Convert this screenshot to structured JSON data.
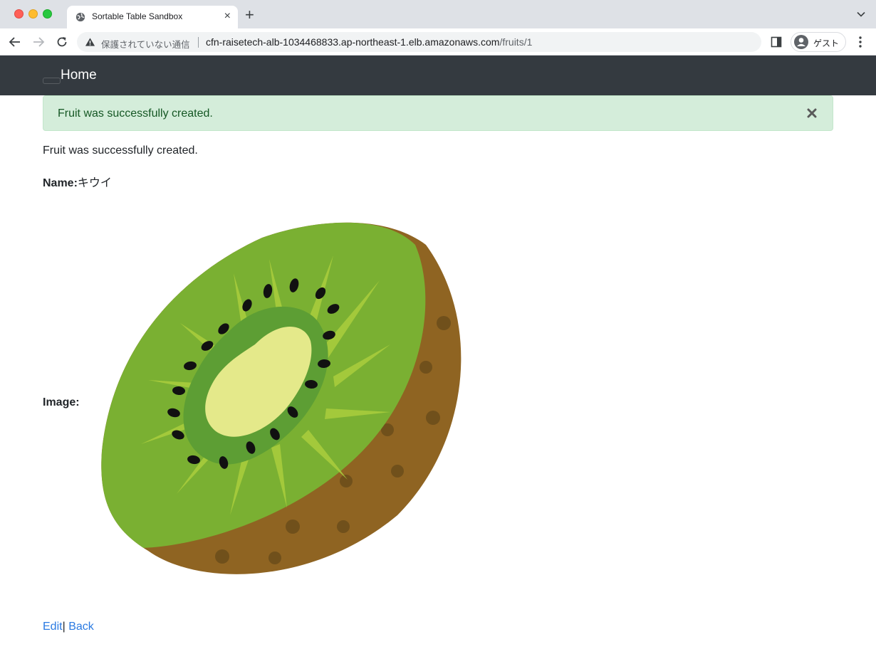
{
  "browser": {
    "tab_title": "Sortable Table Sandbox",
    "tab_close": "×",
    "new_tab": "+",
    "security_text": "保護されていない通信",
    "url_host": "cfn-raisetech-alb-1034468833.ap-northeast-1.elb.amazonaws.com",
    "url_path": "/fruits/1",
    "profile_label": "ゲスト"
  },
  "navbar": {
    "brand": "Home"
  },
  "flash": {
    "message": "Fruit was successfully created."
  },
  "page": {
    "notice": "Fruit was successfully created.",
    "name_label": "Name:",
    "name_value": "キウイ",
    "image_label": "Image:",
    "edit_link": "Edit",
    "separator": "|",
    "back_link": "Back"
  },
  "colors": {
    "navbar_bg": "#343a40",
    "alert_bg": "#d4edda",
    "alert_text": "#155724",
    "link": "#2a7ae2"
  },
  "icons": {
    "favicon": "globe-icon",
    "warning": "warning-triangle-icon",
    "alert_close": "close-icon"
  }
}
